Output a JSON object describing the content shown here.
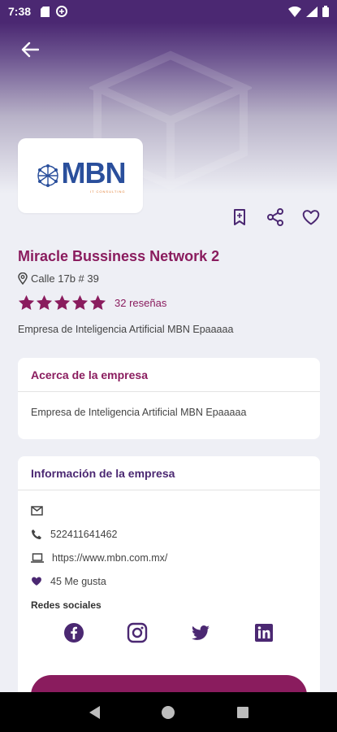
{
  "status_bar": {
    "time": "7:38"
  },
  "company": {
    "name": "Miracle Bussiness Network 2",
    "address": "Calle 17b # 39",
    "rating": 5,
    "reviews_label": "32 reseñas",
    "short_description": "Empresa de Inteligencia Artificial MBN Epaaaaa",
    "logo_text": "MBN",
    "logo_subtext": "IT CONSULTING"
  },
  "about_card": {
    "title": "Acerca de la empresa",
    "body": "Empresa de Inteligencia Artificial MBN Epaaaaa"
  },
  "info_card": {
    "title": "Información de la empresa",
    "email": "",
    "phone": "522411641462",
    "website": "https://www.mbn.com.mx/",
    "likes": "45 Me gusta",
    "social_title": "Redes sociales",
    "social_networks": [
      "facebook",
      "instagram",
      "twitter",
      "linkedin"
    ]
  },
  "colors": {
    "primary": "#8a1c5e",
    "secondary": "#4b2872",
    "background": "#eeeff5"
  }
}
